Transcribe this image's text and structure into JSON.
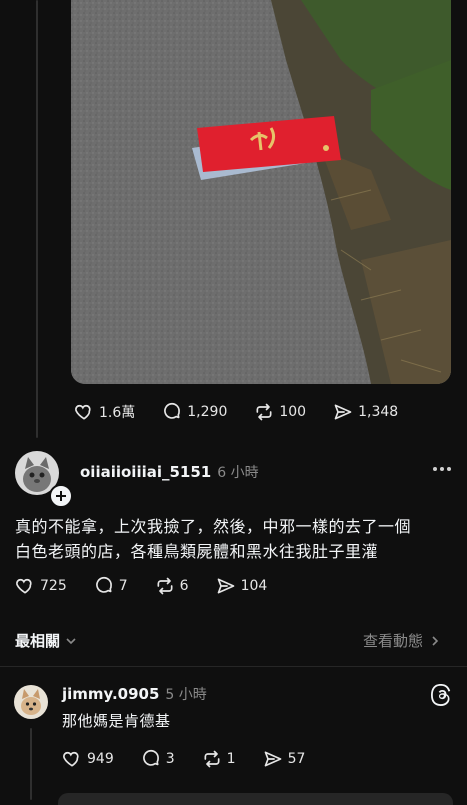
{
  "first_post": {
    "image_alt_icon": "red-envelope-photo",
    "actions": {
      "likes": "1.6萬",
      "comments": "1,290",
      "reposts": "100",
      "shares": "1,348"
    }
  },
  "reply_post": {
    "username": "oiiaiioiiiai_5151",
    "time": "6 小時",
    "text_line1": "真的不能拿，上次我撿了，然後，中邪一樣的去了一個",
    "text_line2": "白色老頭的店，各種鳥類屍體和黑水往我肚子里灌",
    "actions": {
      "likes": "725",
      "comments": "7",
      "reposts": "6",
      "shares": "104"
    }
  },
  "sort_bar": {
    "sort_label": "最相關",
    "view_activity": "查看動態"
  },
  "comment": {
    "username": "jimmy.0905",
    "time": "5 小時",
    "text": "那他媽是肯德基",
    "actions": {
      "likes": "949",
      "comments": "3",
      "reposts": "1",
      "shares": "57"
    }
  },
  "colors": {
    "background": "#0f0f0f",
    "text": "#f3f5f7",
    "muted": "#8a8a8a",
    "envelope_red": "#e0202e",
    "envelope_gold": "#e7c36a"
  }
}
